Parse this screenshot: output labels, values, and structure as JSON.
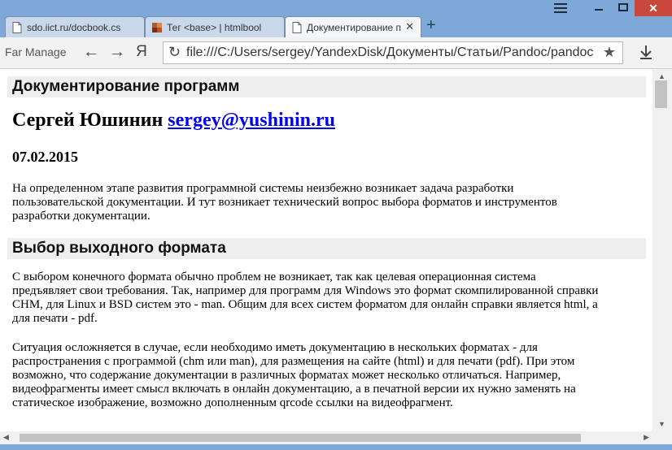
{
  "tabs": [
    {
      "label": "sdo.iict.ru/docbook.cs",
      "icon": "page-icon"
    },
    {
      "label": "Тег <base> | htmlbool",
      "icon": "site-favicon-icon"
    },
    {
      "label": "Документирование п",
      "icon": "page-icon",
      "active": true
    }
  ],
  "window": {
    "close_label": "✕"
  },
  "toolbar": {
    "far_manager": "Far Manage",
    "yandex": "Я",
    "url": "file:///C:/Users/sergey/YandexDisk/Документы/Статьи/Pandoc/pandoc.h"
  },
  "doc": {
    "title": "Документирование программ",
    "author_name": "Сергей Юшинин",
    "author_email": "sergey@yushinin.ru",
    "date": "07.02.2015",
    "p1_l1": "На определенном этапе развития программной системы неизбежно возникает задача разработки",
    "p1_l2": "пользовательской документации. И тут возникает технический вопрос выбора форматов и инструментов",
    "p1_l3": "разработки документации.",
    "section1": "Выбор выходного формата",
    "p2_l1": "С выбором конечного формата обычно проблем не возникает, так как целевая операционная система",
    "p2_l2": "предъявляет свои требования. Так, например для программ для Windows это формат скомпилированной справки",
    "p2_l3": "CHM, для Linux и BSD систем это - man. Общим для всех систем форматом для онлайн справки является html, а",
    "p2_l4": "для печати - pdf.",
    "p3_l1": "Ситуация осложняется в случае, если необходимо иметь документацию в нескольких форматах - для",
    "p3_l2": "распространения с программой (chm или man), для размещения на сайте (html) и для печати (pdf). При этом",
    "p3_l3": "возможно, что содержание документации в различных форматах может несколько отличаться. Например,",
    "p3_l4": "видеофрагменты имеет смысл включать в онлайн документацию, а в печатной версии их нужно заменять на",
    "p3_l5": "статическое изображение, возможно дополненным qrcode ссылки на видеофрагмент."
  }
}
